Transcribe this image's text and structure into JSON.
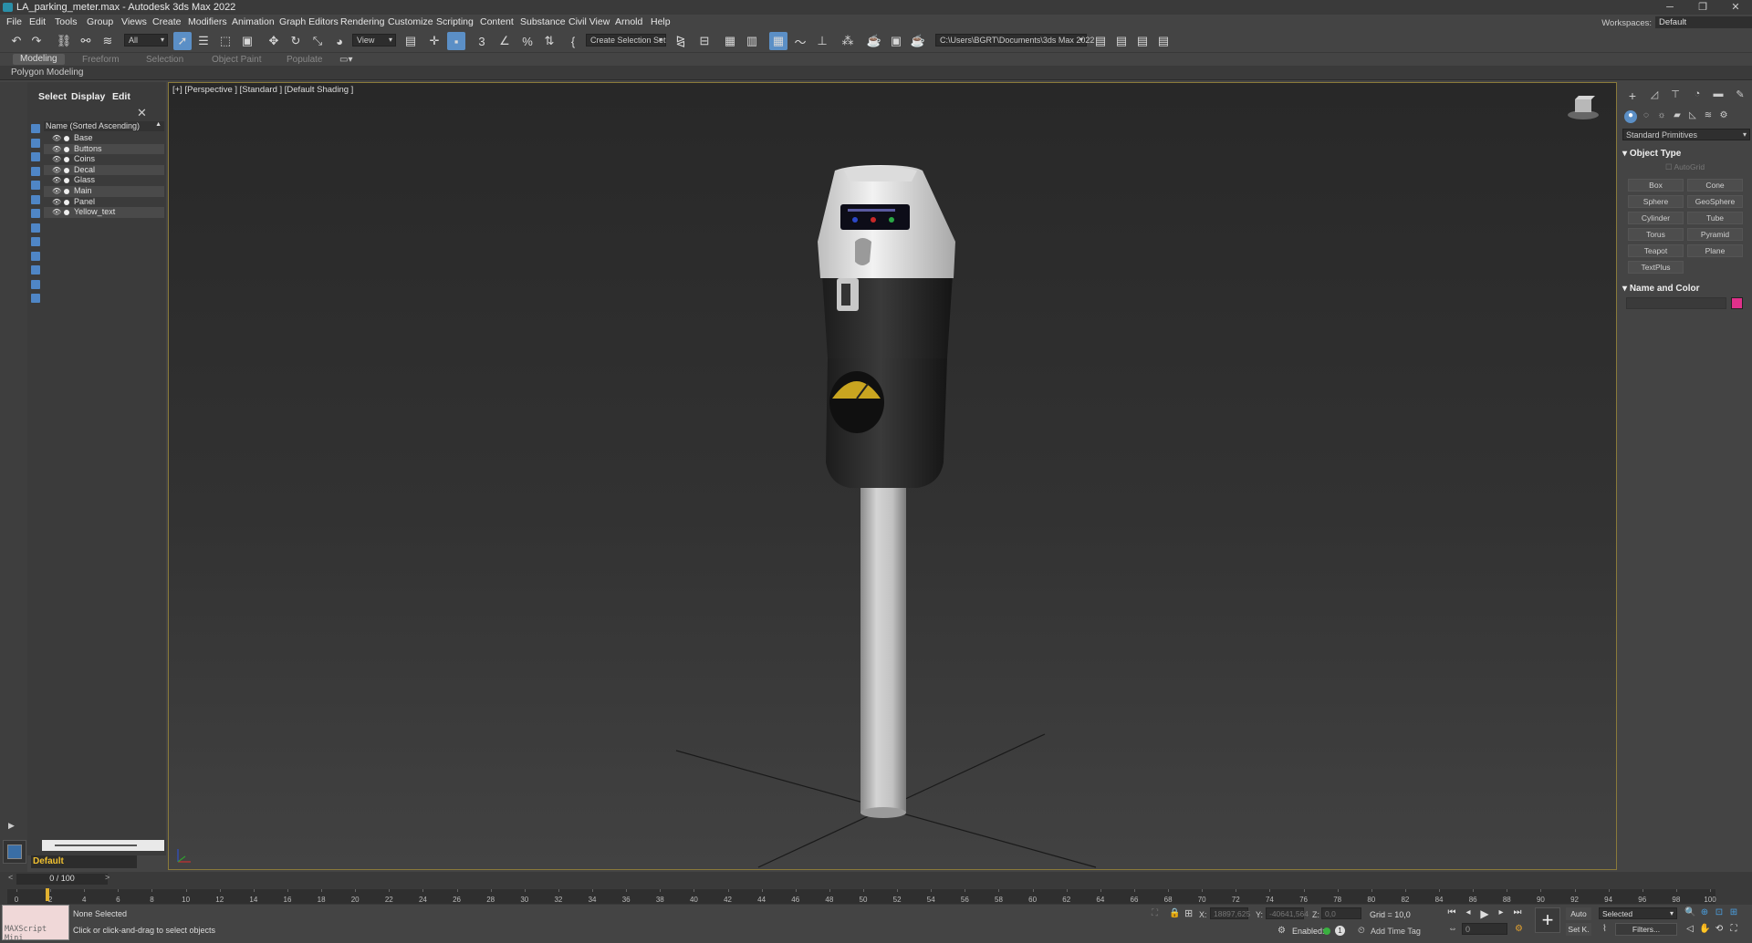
{
  "window": {
    "title": "LA_parking_meter.max - Autodesk 3ds Max 2022",
    "minimize": "─",
    "maximize": "❐",
    "close": "✕"
  },
  "menubar": {
    "items": [
      "File",
      "Edit",
      "Tools",
      "Group",
      "Views",
      "Create",
      "Modifiers",
      "Animation",
      "Graph Editors",
      "Rendering",
      "Customize",
      "Scripting",
      "Content",
      "Substance",
      "Civil View",
      "Arnold",
      "Help"
    ],
    "workspaces_label": "Workspaces:",
    "workspace_value": "Default"
  },
  "toolbar": {
    "selection_filter": "All",
    "ref_coord": "View",
    "named_selection": "Create Selection Set",
    "project_path": "C:\\Users\\BGRT\\Documents\\3ds Max 2022"
  },
  "ribbon": {
    "tabs": [
      "Modeling",
      "Freeform",
      "Selection",
      "Object Paint",
      "Populate"
    ],
    "active_tab": "Modeling",
    "panel": "Polygon Modeling"
  },
  "scene_explorer": {
    "tabs": [
      "Select",
      "Display",
      "Edit"
    ],
    "column_header": "Name (Sorted Ascending)",
    "sort_arrow": "▲",
    "close": "✕",
    "objects": [
      "Base",
      "Buttons",
      "Coins",
      "Decal",
      "Glass",
      "Main",
      "Panel",
      "Yellow_text"
    ],
    "layer": "Default"
  },
  "viewport": {
    "label": "[+] [Perspective ] [Standard ] [Default Shading ]"
  },
  "command_panel": {
    "dropdown": "Standard Primitives",
    "object_type_title": "Object Type",
    "autogrid": "AutoGrid",
    "primitives": [
      "Box",
      "Cone",
      "Sphere",
      "GeoSphere",
      "Cylinder",
      "Tube",
      "Torus",
      "Pyramid",
      "Teapot",
      "Plane",
      "TextPlus"
    ],
    "name_color_title": "Name and Color",
    "color": "#e0308a"
  },
  "timeline": {
    "frame_display": "0 / 100",
    "prev": "<",
    "next": ">",
    "ticks": [
      "0",
      "2",
      "4",
      "6",
      "8",
      "10",
      "12",
      "14",
      "16",
      "18",
      "20",
      "22",
      "24",
      "26",
      "28",
      "30",
      "32",
      "34",
      "36",
      "38",
      "40",
      "42",
      "44",
      "46",
      "48",
      "50",
      "52",
      "54",
      "56",
      "58",
      "60",
      "62",
      "64",
      "66",
      "68",
      "70",
      "72",
      "74",
      "76",
      "78",
      "80",
      "82",
      "84",
      "86",
      "88",
      "90",
      "92",
      "94",
      "96",
      "98",
      "100"
    ]
  },
  "status": {
    "maxscript": "MAXScript Mini",
    "selection": "None Selected",
    "prompt": "Click or click-and-drag to select objects",
    "x_label": "X:",
    "x_value": "18897,625",
    "y_label": "Y:",
    "y_value": "-40641,564",
    "z_label": "Z:",
    "z_value": "0,0",
    "grid": "Grid = 10,0",
    "enabled": "Enabled:",
    "add_time_tag": "Add Time Tag",
    "frame_value": "0",
    "auto": "Auto",
    "set_key": "Set K.",
    "selected": "Selected",
    "filters": "Filters..."
  }
}
